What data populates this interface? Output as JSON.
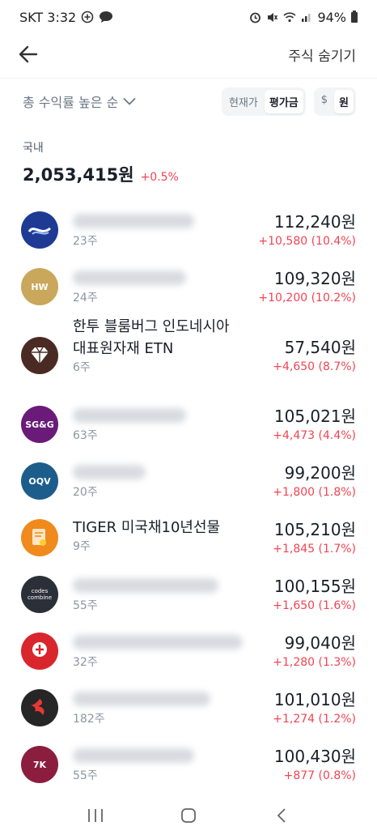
{
  "status_bar": {
    "carrier_time": "SKT 3:32",
    "battery": "94%",
    "left_icons": [
      "plus-circle-icon",
      "chat-bubble-icon"
    ],
    "right_icons": [
      "alarm-icon",
      "mute-icon",
      "wifi-icon",
      "signal-icon",
      "battery-icon"
    ]
  },
  "header": {
    "hide_label": "주식 숨기기"
  },
  "controls": {
    "sort_label": "총 수익률 높은 순",
    "price_toggle": [
      "현재가",
      "평가금"
    ],
    "price_toggle_active": "평가금",
    "currency_toggle": [
      "$",
      "원"
    ],
    "currency_toggle_active": "원"
  },
  "summary": {
    "label": "국내",
    "total": "2,053,415원",
    "change": "+0.5%"
  },
  "colors": {
    "gain": "#f04452",
    "text_primary": "#191f28",
    "text_secondary": "#8b95a1"
  },
  "stocks": [
    {
      "name": "",
      "blurred": true,
      "qty": "23주",
      "value": "112,240원",
      "gain": "+10,580 (10.4%)",
      "logo_color": "#1f3a93",
      "logo_text": "",
      "logo_icon": "wave-logo"
    },
    {
      "name": "",
      "blurred": true,
      "qty": "24주",
      "value": "109,320원",
      "gain": "+10,200 (10.2%)",
      "logo_color": "#c9a75b",
      "logo_text": "HW",
      "logo_icon": "hw-logo"
    },
    {
      "name": "한투 블룸버그 인도네시아 대표원자재 ETN",
      "name_line1": "한투 블룸버그 인도네시아",
      "name_line2": "대표원자재 ETN",
      "blurred": false,
      "qty": "6주",
      "value": "57,540원",
      "gain": "+4,650 (8.7%)",
      "logo_color": "#4a2b23",
      "logo_text": "",
      "logo_icon": "diamond-logo"
    },
    {
      "name": "",
      "blurred": true,
      "qty": "63주",
      "value": "105,021원",
      "gain": "+4,473 (4.4%)",
      "logo_color": "#6a1b7a",
      "logo_text": "SG&G",
      "logo_icon": "sgg-logo"
    },
    {
      "name": "",
      "blurred": true,
      "qty": "20주",
      "value": "99,200원",
      "gain": "+1,800 (1.8%)",
      "logo_color": "#1d5d8c",
      "logo_text": "OQV",
      "logo_icon": "oqv-logo"
    },
    {
      "name": "TIGER 미국채10년선물",
      "blurred": false,
      "qty": "9주",
      "value": "105,210원",
      "gain": "+1,845 (1.7%)",
      "logo_color": "#f08a1c",
      "logo_text": "",
      "logo_icon": "certificate-logo"
    },
    {
      "name": "",
      "blurred": true,
      "qty": "55주",
      "value": "100,155원",
      "gain": "+1,650 (1.6%)",
      "logo_color": "#2b2f38",
      "logo_text": "codes combine",
      "logo_icon": "codes-combine-logo"
    },
    {
      "name": "",
      "blurred": true,
      "qty": "32주",
      "value": "99,040원",
      "gain": "+1,280 (1.3%)",
      "logo_color": "#d9262c",
      "logo_text": "",
      "logo_icon": "red-badge-logo"
    },
    {
      "name": "",
      "blurred": true,
      "qty": "182주",
      "value": "101,010원",
      "gain": "+1,274 (1.2%)",
      "logo_color": "#262626",
      "logo_text": "",
      "logo_icon": "swirl-logo"
    },
    {
      "name": "",
      "blurred": true,
      "qty": "55주",
      "value": "100,430원",
      "gain": "+877 (0.8%)",
      "logo_color": "#8b1e3f",
      "logo_text": "7K",
      "logo_icon": "7k-logo"
    }
  ],
  "nav_bar": {
    "buttons": [
      "recent-apps-icon",
      "home-icon",
      "back-icon"
    ]
  }
}
